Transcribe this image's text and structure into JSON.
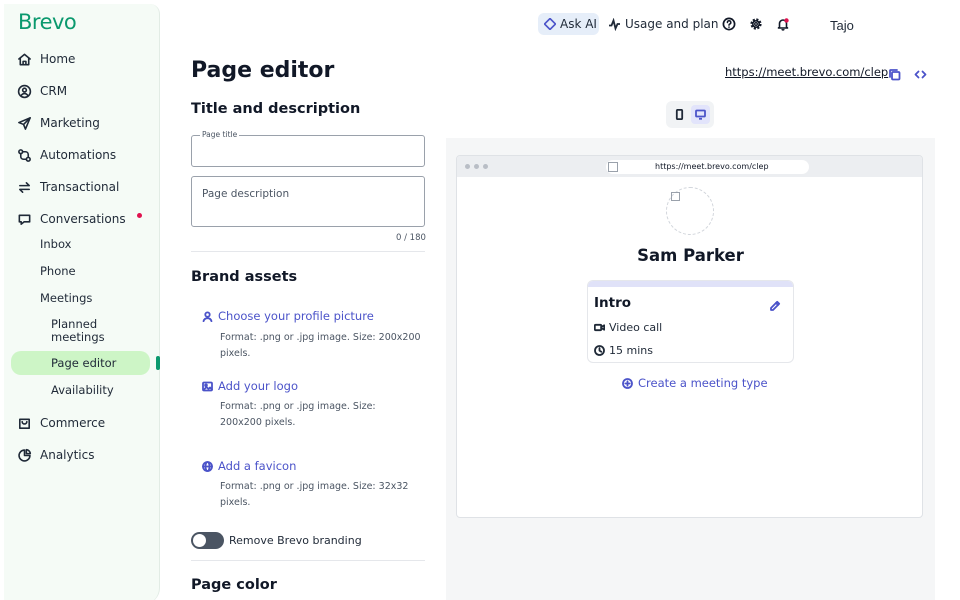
{
  "sidebar": {
    "logo": "Brevo",
    "items": [
      {
        "label": "Home",
        "icon": "home-icon"
      },
      {
        "label": "CRM",
        "icon": "contact-icon"
      },
      {
        "label": "Marketing",
        "icon": "send-icon"
      },
      {
        "label": "Automations",
        "icon": "automation-icon"
      },
      {
        "label": "Transactional",
        "icon": "transfer-icon"
      },
      {
        "label": "Conversations",
        "icon": "chat-icon",
        "badge_color": "#e0124f"
      },
      {
        "label": "Commerce",
        "icon": "shop-icon"
      },
      {
        "label": "Analytics",
        "icon": "pie-chart-icon"
      }
    ],
    "conversations_sub": [
      "Inbox",
      "Phone",
      "Meetings"
    ],
    "meetings_sub": [
      "Planned meetings",
      "Page editor",
      "Availability"
    ],
    "active_item": "Page editor"
  },
  "topbar": {
    "ask_ai": "Ask AI",
    "usage": "Usage and plan",
    "user": "Tajo",
    "icons": [
      "help-icon",
      "settings-icon",
      "notification-icon"
    ]
  },
  "main": {
    "title": "Page editor",
    "page_link": "https://meet.brevo.com/clep",
    "title_section": {
      "heading": "Title and description",
      "page_title_label": "Page title",
      "page_title_value": "",
      "description_placeholder": "Page description",
      "counter": "0 / 180"
    },
    "brand_assets": {
      "heading": "Brand assets",
      "items": [
        {
          "link": "Choose your profile picture",
          "help": "Format: .png or .jpg image. Size: 200x200 pixels.",
          "icon": "user-icon"
        },
        {
          "link": "Add your logo",
          "help": "Format: .png or .jpg image. Size: 200x200 pixels.",
          "icon": "image-icon"
        },
        {
          "link": "Add a favicon",
          "help": "Format: .png or .jpg image. Size: 32x32 pixels.",
          "icon": "globe-icon"
        }
      ],
      "remove_branding": "Remove Brevo branding",
      "remove_branding_on": false
    },
    "page_color": {
      "heading": "Page color"
    }
  },
  "preview": {
    "url": "https://meet.brevo.com/clep",
    "host_name": "Sam Parker",
    "meeting": {
      "title": "Intro",
      "type": "Video call",
      "duration": "15 mins"
    },
    "create_link": "Create a meeting type",
    "device_selected": "desktop"
  },
  "colors": {
    "brand": "#0b996e",
    "accent": "#4b53c9",
    "active_bg": "#cdf5c6"
  }
}
